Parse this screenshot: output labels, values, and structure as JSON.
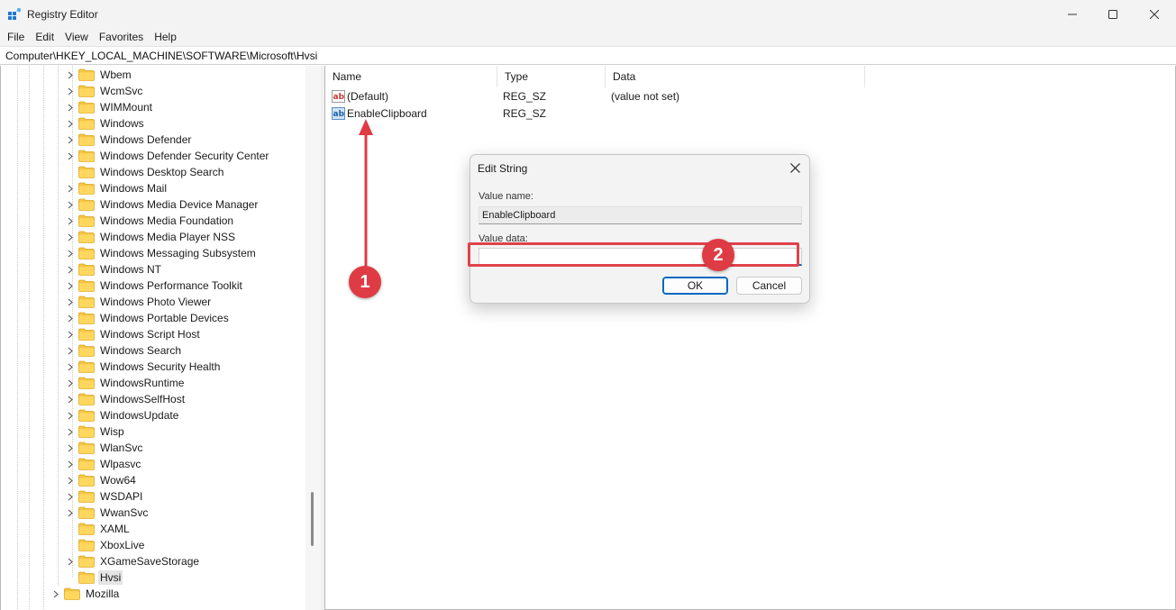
{
  "window": {
    "title": "Registry Editor"
  },
  "menu": [
    "File",
    "Edit",
    "View",
    "Favorites",
    "Help"
  ],
  "address": {
    "path": "Computer\\HKEY_LOCAL_MACHINE\\SOFTWARE\\Microsoft\\Hvsi"
  },
  "tree": {
    "items": [
      {
        "label": "Wbem",
        "expandable": true
      },
      {
        "label": "WcmSvc",
        "expandable": true
      },
      {
        "label": "WIMMount",
        "expandable": true
      },
      {
        "label": "Windows",
        "expandable": true
      },
      {
        "label": "Windows Defender",
        "expandable": true
      },
      {
        "label": "Windows Defender Security Center",
        "expandable": true
      },
      {
        "label": "Windows Desktop Search",
        "expandable": false
      },
      {
        "label": "Windows Mail",
        "expandable": true
      },
      {
        "label": "Windows Media Device Manager",
        "expandable": true
      },
      {
        "label": "Windows Media Foundation",
        "expandable": true
      },
      {
        "label": "Windows Media Player NSS",
        "expandable": true
      },
      {
        "label": "Windows Messaging Subsystem",
        "expandable": true
      },
      {
        "label": "Windows NT",
        "expandable": true
      },
      {
        "label": "Windows Performance Toolkit",
        "expandable": true
      },
      {
        "label": "Windows Photo Viewer",
        "expandable": true
      },
      {
        "label": "Windows Portable Devices",
        "expandable": true
      },
      {
        "label": "Windows Script Host",
        "expandable": true
      },
      {
        "label": "Windows Search",
        "expandable": true
      },
      {
        "label": "Windows Security Health",
        "expandable": true
      },
      {
        "label": "WindowsRuntime",
        "expandable": true
      },
      {
        "label": "WindowsSelfHost",
        "expandable": true
      },
      {
        "label": "WindowsUpdate",
        "expandable": true
      },
      {
        "label": "Wisp",
        "expandable": true
      },
      {
        "label": "WlanSvc",
        "expandable": true
      },
      {
        "label": "Wlpasvc",
        "expandable": true
      },
      {
        "label": "Wow64",
        "expandable": true
      },
      {
        "label": "WSDAPI",
        "expandable": true
      },
      {
        "label": "WwanSvc",
        "expandable": true
      },
      {
        "label": "XAML",
        "expandable": false
      },
      {
        "label": "XboxLive",
        "expandable": false
      },
      {
        "label": "XGameSaveStorage",
        "expandable": true
      },
      {
        "label": "Hvsi",
        "expandable": false,
        "selected": true
      },
      {
        "label": "Mozilla",
        "expandable": true,
        "parent_level": true
      }
    ]
  },
  "values_list": {
    "columns": {
      "name": "Name",
      "type": "Type",
      "data": "Data"
    },
    "rows": [
      {
        "name": "(Default)",
        "type": "REG_SZ",
        "data": "(value not set)",
        "icon": "string-value-icon"
      },
      {
        "name": "EnableClipboard",
        "type": "REG_SZ",
        "data": "",
        "icon": "string-value-icon"
      }
    ]
  },
  "dialog": {
    "title": "Edit String",
    "value_name_label": "Value name:",
    "value_name": "EnableClipboard",
    "value_data_label": "Value data:",
    "value_data": "",
    "ok_label": "OK",
    "cancel_label": "Cancel"
  },
  "annotations": {
    "step1": "1",
    "step2": "2",
    "color": "#df3b44"
  }
}
